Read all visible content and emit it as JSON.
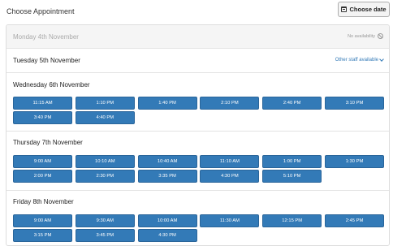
{
  "header": {
    "title": "Choose Appointment",
    "choose_date_label": "Choose date"
  },
  "days": [
    {
      "label": "Monday 4th November",
      "status": "No availability",
      "times": []
    },
    {
      "label": "Tuesday 5th November",
      "link": "Other staff available",
      "times": []
    },
    {
      "label": "Wednesday 6th November",
      "times": [
        "11:15 AM",
        "1:10 PM",
        "1:40 PM",
        "2:10 PM",
        "2:40 PM",
        "3:10 PM",
        "3:40 PM",
        "4:40 PM"
      ]
    },
    {
      "label": "Thursday 7th November",
      "times": [
        "9:00 AM",
        "10:10 AM",
        "10:40 AM",
        "11:10 AM",
        "1:00 PM",
        "1:30 PM",
        "2:00 PM",
        "2:30 PM",
        "3:35 PM",
        "4:30 PM",
        "5:10 PM"
      ]
    },
    {
      "label": "Friday 8th November",
      "times": [
        "9:00 AM",
        "9:30 AM",
        "10:00 AM",
        "11:30 AM",
        "12:15 PM",
        "2:45 PM",
        "3:15 PM",
        "3:45 PM",
        "4:30 PM"
      ]
    }
  ]
}
